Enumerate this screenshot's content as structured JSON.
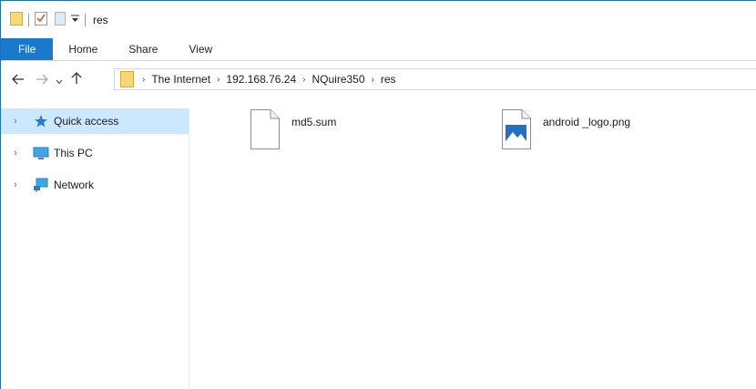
{
  "window": {
    "title": "res"
  },
  "ribbon": {
    "tabs": [
      {
        "label": "File"
      },
      {
        "label": "Home"
      },
      {
        "label": "Share"
      },
      {
        "label": "View"
      }
    ]
  },
  "nav": {
    "back_icon": "back-arrow-icon",
    "forward_icon": "forward-arrow-icon",
    "recent_icon": "chevron-down-icon",
    "up_icon": "up-arrow-icon",
    "breadcrumbs": [
      "The Internet",
      "192.168.76.24",
      "NQuire350",
      "res"
    ]
  },
  "sidebar": {
    "items": [
      {
        "label": "Quick access",
        "icon": "star-icon",
        "selected": true
      },
      {
        "label": "This PC",
        "icon": "computer-icon",
        "selected": false
      },
      {
        "label": "Network",
        "icon": "network-icon",
        "selected": false
      }
    ]
  },
  "files": [
    {
      "name": "md5.sum",
      "icon": "blank-file-icon"
    },
    {
      "name": "android _logo.png",
      "icon": "image-file-icon"
    }
  ],
  "colors": {
    "accent": "#1979ca",
    "selection": "#cce8ff",
    "folder": "#f8d775"
  }
}
